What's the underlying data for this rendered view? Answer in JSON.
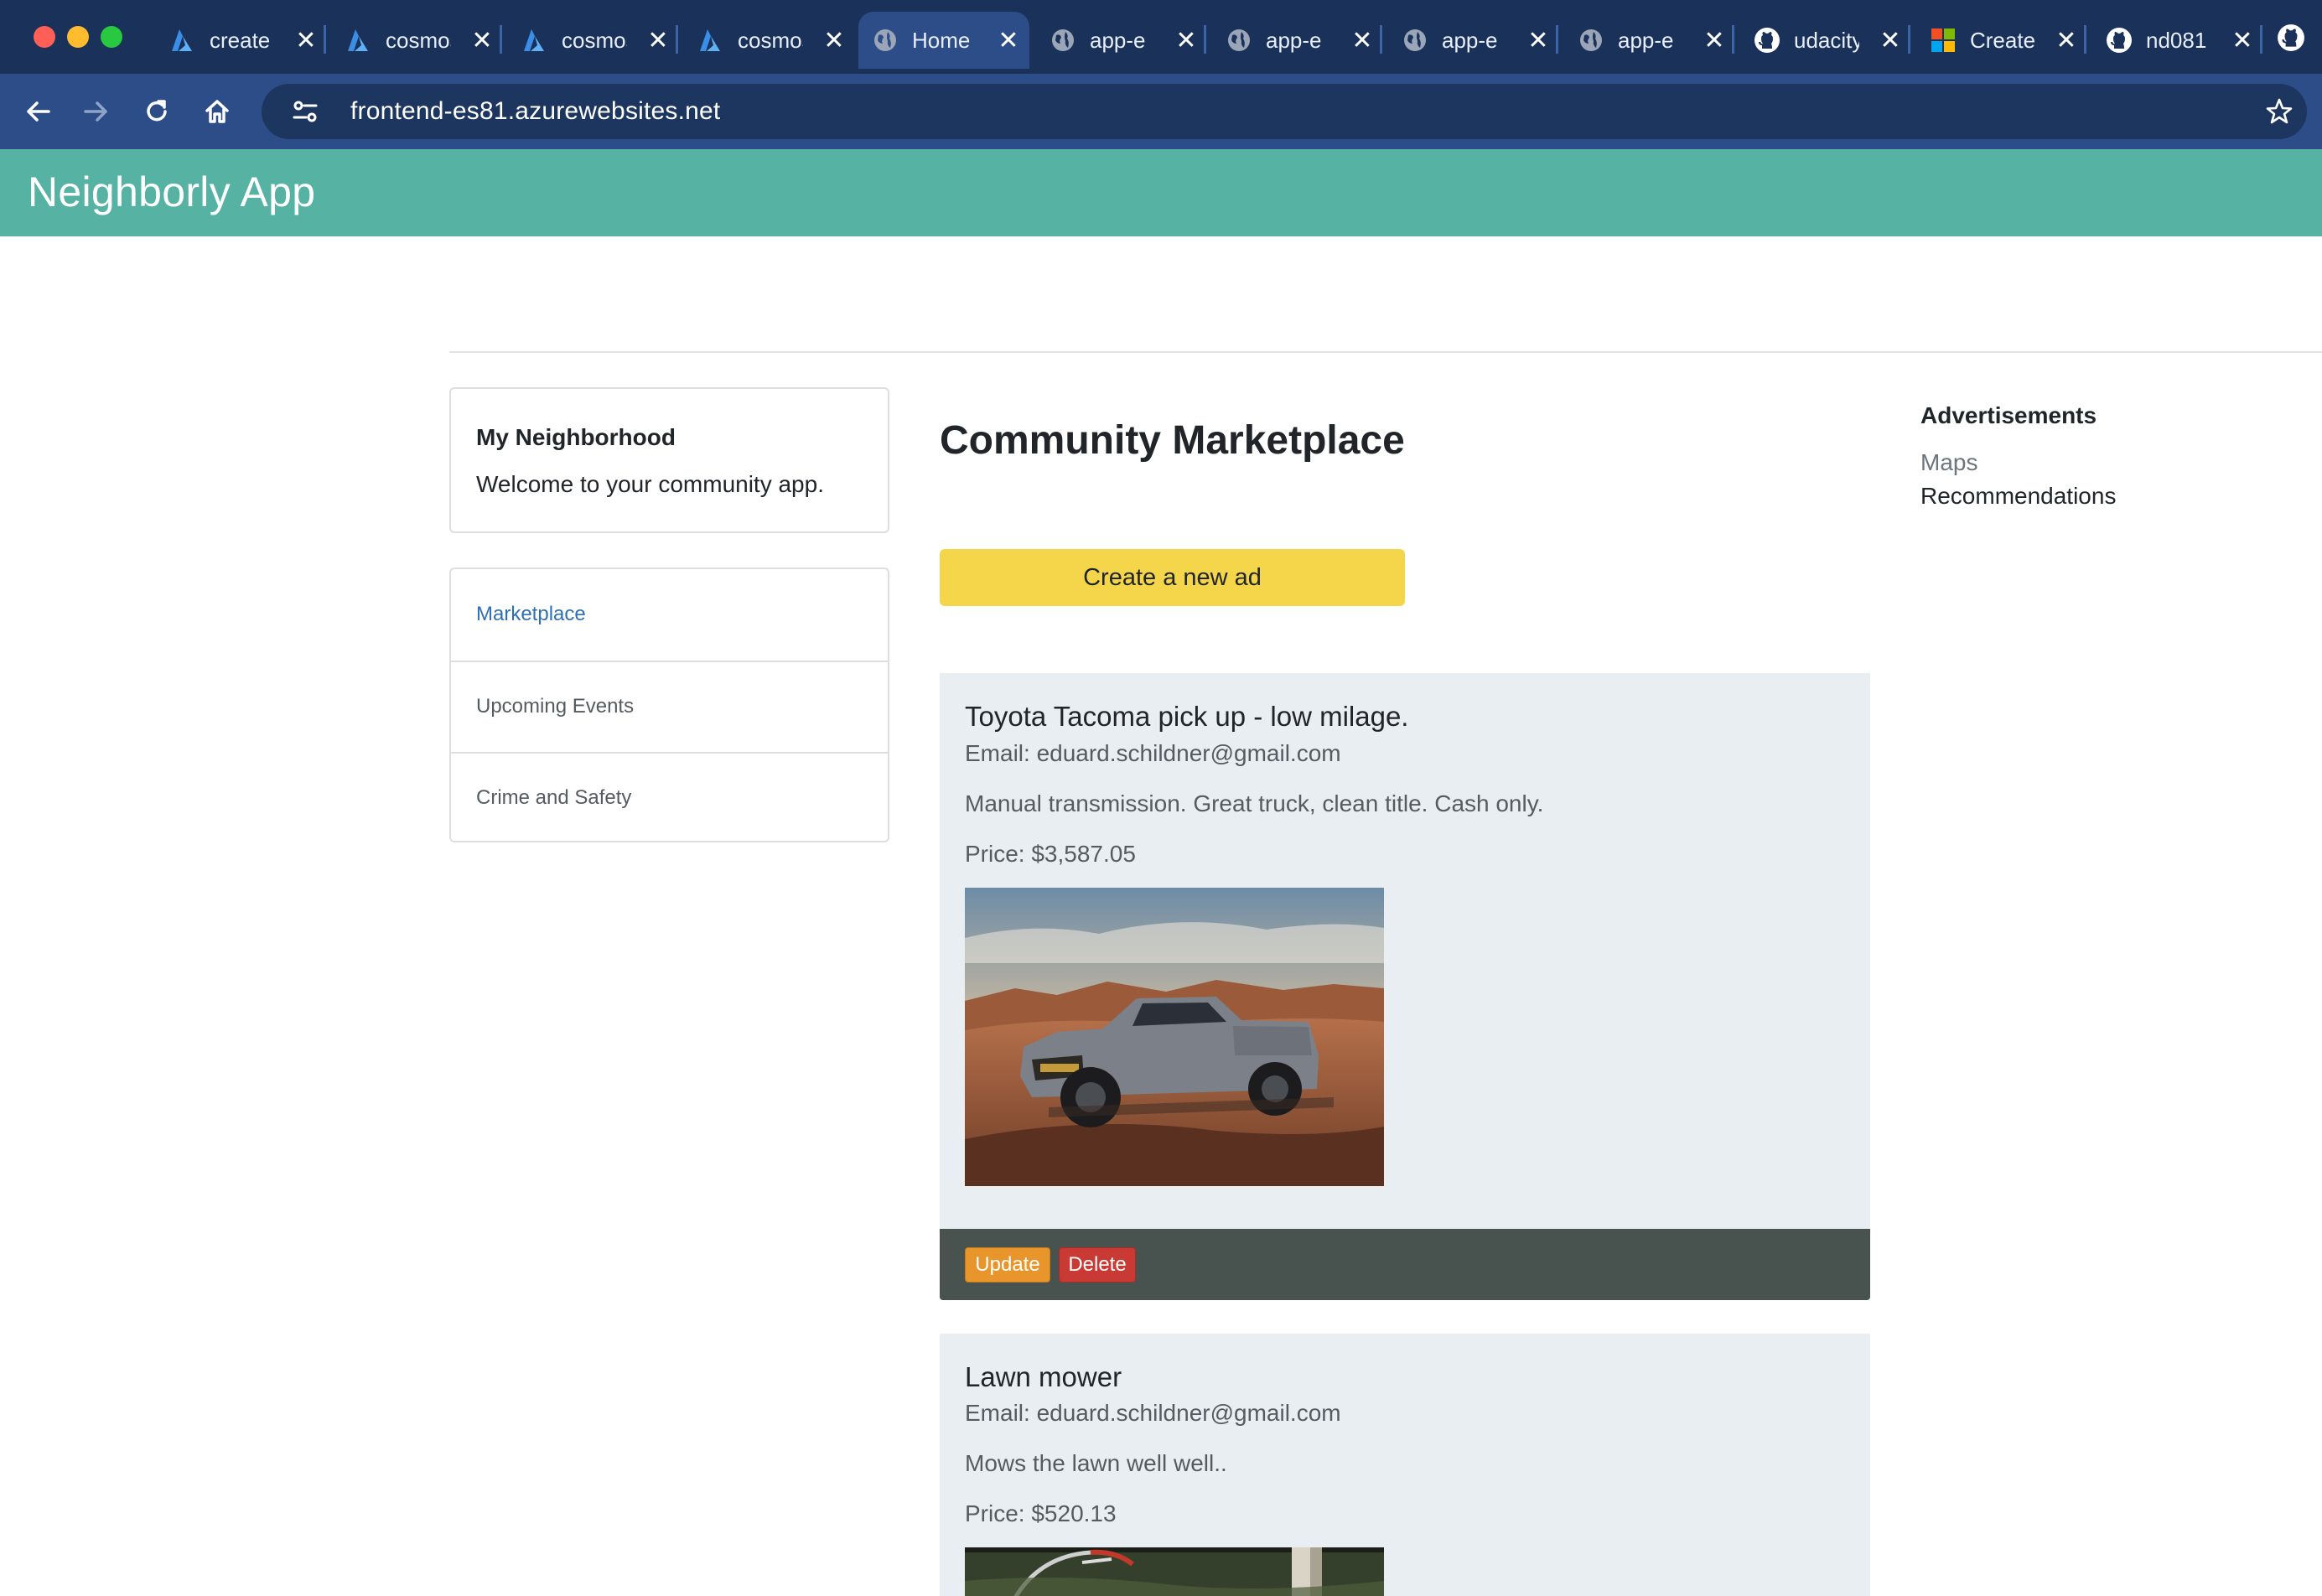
{
  "browser": {
    "tabs": [
      {
        "title": "create",
        "icon": "azure-icon",
        "active": false
      },
      {
        "title": "cosmos",
        "icon": "azure-icon",
        "active": false
      },
      {
        "title": "cosmos",
        "icon": "azure-icon",
        "active": false
      },
      {
        "title": "cosmos",
        "icon": "azure-icon",
        "active": false
      },
      {
        "title": "Home",
        "icon": "globe-icon",
        "active": true
      },
      {
        "title": "app-e",
        "icon": "globe-icon",
        "active": false
      },
      {
        "title": "app-e",
        "icon": "globe-icon",
        "active": false
      },
      {
        "title": "app-e",
        "icon": "globe-icon",
        "active": false
      },
      {
        "title": "app-e",
        "icon": "globe-icon",
        "active": false
      },
      {
        "title": "udacity",
        "icon": "github-icon",
        "active": false
      },
      {
        "title": "Create",
        "icon": "microsoft-icon",
        "active": false
      },
      {
        "title": "nd081",
        "icon": "github-icon",
        "active": false
      }
    ],
    "url": "frontend-es81.azurewebsites.net",
    "close_glyph": "✕"
  },
  "app": {
    "title": "Neighborly App",
    "header_color": "#56b2a2"
  },
  "sidebar": {
    "neighborhood_title": "My Neighborhood",
    "neighborhood_text": "Welcome to your community app.",
    "nav": [
      {
        "label": "Marketplace",
        "active": true
      },
      {
        "label": "Upcoming Events",
        "active": false
      },
      {
        "label": "Crime and Safety",
        "active": false
      }
    ]
  },
  "main": {
    "title": "Community Marketplace",
    "create_button": "Create a new ad",
    "ads": [
      {
        "title": "Toyota Tacoma pick up - low milage.",
        "email": "Email: eduard.schildner@gmail.com",
        "description": "Manual transmission. Great truck, clean title. Cash only.",
        "price": "Price: $3,587.05",
        "image": "pickup-truck-photo",
        "update_label": "Update",
        "delete_label": "Delete"
      },
      {
        "title": "Lawn mower",
        "email": "Email: eduard.schildner@gmail.com",
        "description": "Mows the lawn well well..",
        "price": "Price: $520.13",
        "image": "lawn-mower-photo"
      }
    ]
  },
  "advertisements": {
    "title": "Advertisements",
    "links": [
      "Maps",
      "Recommendations"
    ]
  },
  "colors": {
    "accent_yellow": "#f5d64a",
    "update_orange": "#e8962c",
    "delete_red": "#c93a35",
    "link_blue": "#2f6fb3"
  }
}
